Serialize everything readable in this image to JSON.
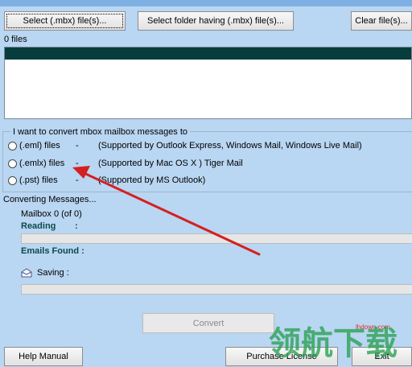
{
  "toolbar": {
    "select_files_label": "Select (.mbx) file(s)...",
    "select_folder_label": "Select folder having (.mbx) file(s)...",
    "clear_files_label": "Clear file(s)..."
  },
  "files": {
    "count_label": "0 files"
  },
  "options": {
    "legend": "I want to convert mbox mailbox messages to",
    "items": [
      {
        "name": "(.eml) files",
        "dash": "-",
        "desc": "(Supported by Outlook Express, Windows Mail, Windows Live Mail)"
      },
      {
        "name": "(.emlx) files",
        "dash": "-",
        "desc": "(Supported by Mac OS X ) Tiger Mail"
      },
      {
        "name": "(.pst) files",
        "dash": "-",
        "desc": "(Supported by MS Outlook)"
      }
    ]
  },
  "progress": {
    "title": "Converting Messages...",
    "mailbox_label": "Mailbox",
    "mailbox_value": "0 (of 0)",
    "reading_label": "Reading",
    "reading_colon": ":",
    "emails_found_label": "Emails Found :",
    "saving_label": "Saving :",
    "reading_progress": 0,
    "saving_progress": 0
  },
  "actions": {
    "convert_label": "Convert",
    "help_label": "Help Manual",
    "purchase_label": "Purchase License",
    "exit_label": "Exit"
  },
  "watermark": {
    "site": "lhdown.com",
    "text": "领航下载"
  },
  "colors": {
    "background": "#b9d6f2",
    "list_header": "#083d3d",
    "arrow": "#d42020"
  },
  "icons": {
    "saving": "envelope-icon"
  }
}
